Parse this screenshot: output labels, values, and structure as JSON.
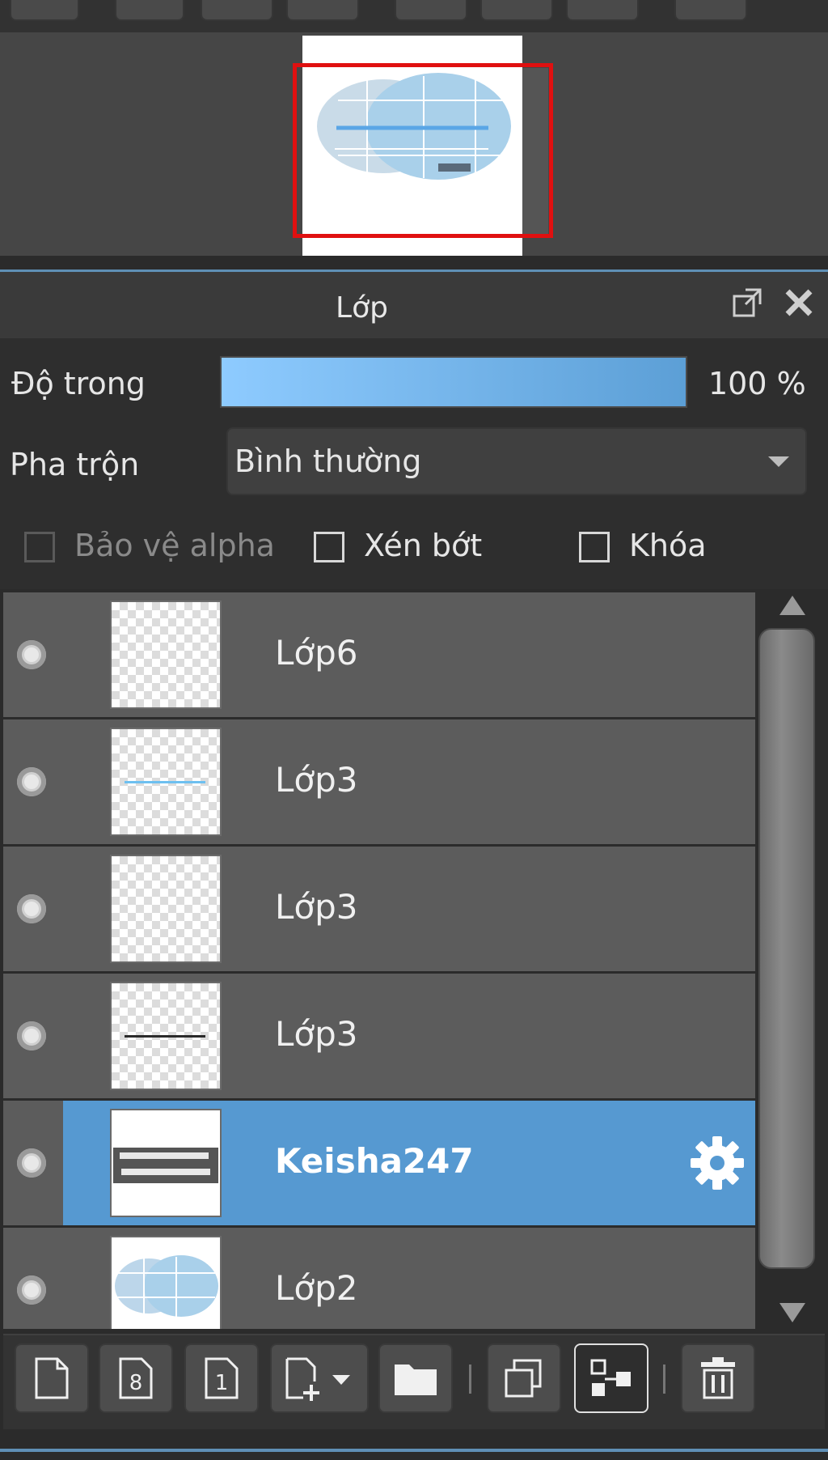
{
  "panel": {
    "title": "Lớp"
  },
  "opacity": {
    "label": "Độ trong",
    "value_text": "100 %",
    "value": 100
  },
  "blend": {
    "label": "Pha trộn",
    "selected": "Bình thường"
  },
  "checkboxes": [
    {
      "label": "Bảo vệ alpha",
      "checked": false,
      "enabled": false
    },
    {
      "label": "Xén bớt",
      "checked": false,
      "enabled": true
    },
    {
      "label": "Khóa",
      "checked": false,
      "enabled": true
    }
  ],
  "layers": [
    {
      "name": "Lớp6",
      "visible": true,
      "selected": false,
      "thumb": "empty"
    },
    {
      "name": "Lớp3",
      "visible": true,
      "selected": false,
      "thumb": "blue-line"
    },
    {
      "name": "Lớp3",
      "visible": true,
      "selected": false,
      "thumb": "empty"
    },
    {
      "name": "Lớp3",
      "visible": true,
      "selected": false,
      "thumb": "dark-line"
    },
    {
      "name": "Keisha247",
      "visible": true,
      "selected": true,
      "thumb": "text"
    },
    {
      "name": "Lớp2",
      "visible": true,
      "selected": false,
      "thumb": "shape"
    }
  ],
  "icons": {
    "popout": "popout-icon",
    "close": "close-icon",
    "settings": "gear-icon"
  },
  "colors": {
    "accent": "#5699d1",
    "selection_red": "#e01010"
  }
}
